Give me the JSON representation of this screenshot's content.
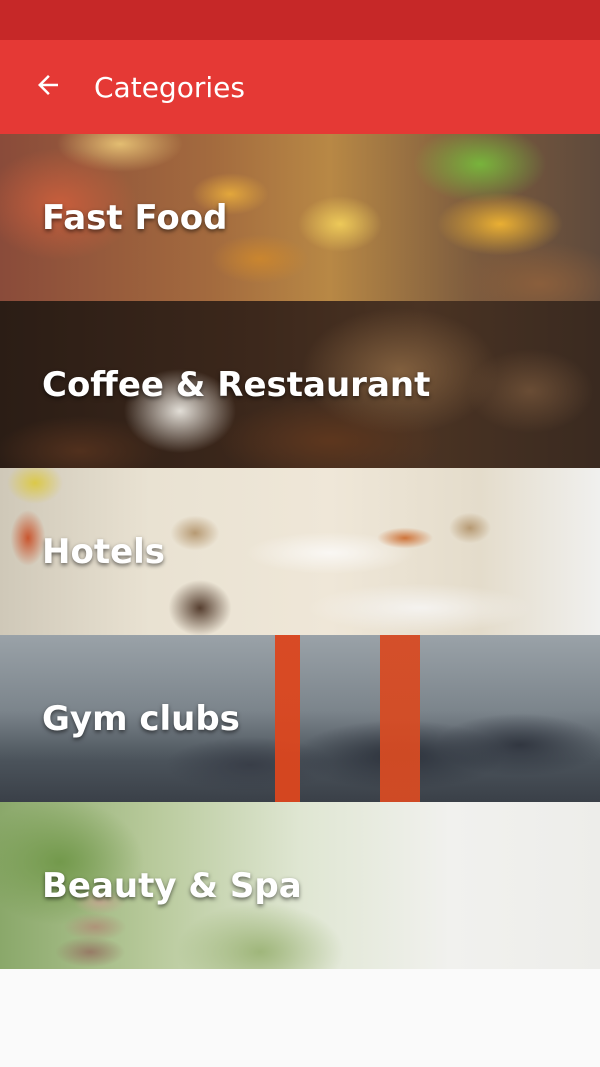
{
  "app_bar": {
    "title": "Categories",
    "back_icon": "arrow-left-icon",
    "color": "#e53935",
    "status_bar_color": "#c62828"
  },
  "categories": [
    {
      "label": "Fast Food"
    },
    {
      "label": "Coffee & Restaurant"
    },
    {
      "label": "Hotels"
    },
    {
      "label": "Gym clubs"
    },
    {
      "label": "Beauty & Spa"
    }
  ]
}
